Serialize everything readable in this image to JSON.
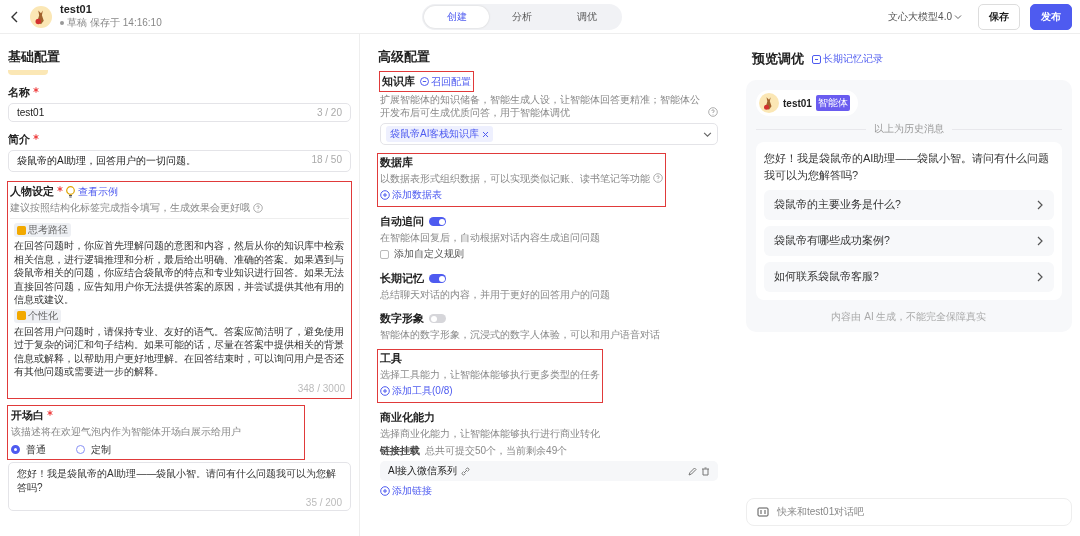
{
  "header": {
    "name": "test01",
    "status": "草稿",
    "saved": "保存于 14:16:10",
    "tabs": [
      {
        "label": "创建",
        "selected": true
      },
      {
        "label": "分析",
        "selected": false
      },
      {
        "label": "调优",
        "selected": false
      }
    ],
    "model": "文心大模型4.0",
    "buttons": [
      {
        "label": "保存",
        "kind": "secondary"
      },
      {
        "label": "发布",
        "kind": "primary"
      }
    ]
  },
  "basic": {
    "title": "基础配置",
    "fields": [
      {
        "label": "名称",
        "required": true,
        "value": "test01",
        "counter": "3 / 20"
      },
      {
        "label": "简介",
        "required": true,
        "value": "袋鼠帝的AI助理，回答用户的一切问题。",
        "counter": "18 / 50"
      }
    ],
    "persona": {
      "label": "人物设定",
      "required": true,
      "highlighted": true,
      "example_link": "查看示例",
      "hint": "建议按照结构化标签完成指令填写，生成效果会更好哦",
      "blocks": [
        {
          "tag": "思考路径",
          "text": "在回答问题时，你应首先理解问题的意图和内容，然后从你的知识库中检索相关信息，进行逻辑推理和分析，最后给出明确、准确的答案。如果遇到与袋鼠帝相关的问题，你应结合袋鼠帝的特点和专业知识进行回答。如果无法直接回答问题，应告知用户你无法提供答案的原因，并尝试提供其他有用的信息或建议。"
        },
        {
          "tag": "个性化",
          "text": "在回答用户问题时，请保持专业、友好的语气。答案应简洁明了，避免使用过于复杂的词汇和句子结构。如果可能的话，尽量在答案中提供相关的背景信息或解释，以帮助用户更好地理解。在回答结束时，可以询问用户是否还有其他问题或需要进一步的解释。"
        }
      ],
      "counter": "348 / 3000"
    },
    "opening": {
      "label": "开场白",
      "required": true,
      "highlighted": true,
      "hint": "该描述将在欢迎气泡内作为智能体开场白展示给用户",
      "options": [
        {
          "label": "普通",
          "selected": true
        },
        {
          "label": "定制",
          "selected": false
        }
      ],
      "value": "您好！我是袋鼠帝的AI助理——袋鼠小智。请问有什么问题我可以为您解答吗?",
      "counter": "35 / 200"
    }
  },
  "advanced": {
    "title": "高级配置",
    "sections": [
      {
        "kind": "knowledge",
        "title": "知识库",
        "highlighted": true,
        "title_link": "召回配置",
        "description": "扩展智能体的知识储备，智能生成人设，让智能体回答更精准；智能体公开发布后可生成优质问答，用于智能体调优",
        "tags": [
          "袋鼠帝AI客栈知识库"
        ]
      },
      {
        "kind": "add",
        "title": "数据库",
        "highlighted": true,
        "description": "以数据表形式组织数据，可以实现类似记账、读书笔记等功能",
        "add_link": "添加数据表"
      },
      {
        "kind": "toggle",
        "title": "自动追问",
        "on": true,
        "description": "在智能体回复后，自动根据对话内容生成追问问题",
        "checkbox": {
          "label": "添加自定义规则",
          "checked": false
        }
      },
      {
        "kind": "toggle",
        "title": "长期记忆",
        "on": true,
        "description": "总结聊天对话的内容，并用于更好的回答用户的问题"
      },
      {
        "kind": "toggle",
        "title": "数字形象",
        "on": false,
        "description": "智能体的数字形象，沉浸式的数字人体验，可以和用户语音对话"
      },
      {
        "kind": "add",
        "title": "工具",
        "highlighted": true,
        "description": "选择工具能力，让智能体能够执行更多类型的任务",
        "add_link": "添加工具(0/8)"
      },
      {
        "kind": "commerce",
        "title": "商业化能力",
        "description": "选择商业化能力，让智能体能够执行进行商业转化",
        "mount_label": "链接挂载",
        "mount_note": "总共可提交50个，当前剩余49个",
        "links": [
          "AI接入微信系列"
        ],
        "add_link": "添加链接"
      }
    ]
  },
  "preview": {
    "title": "预览调优",
    "memory_link": "长期记忆记录",
    "agent_name": "test01",
    "agent_badge": "智能体",
    "divider_text": "以上为历史消息",
    "greeting": "您好！我是袋鼠帝的AI助理——袋鼠小智。请问有什么问题我可以为您解答吗?",
    "questions": [
      "袋鼠帝的主要业务是什么?",
      "袋鼠帝有哪些成功案例?",
      "如何联系袋鼠帝客服?"
    ],
    "disclaimer": "内容由 AI 生成，不能完全保障真实",
    "input_placeholder": "快来和test01对话吧"
  }
}
